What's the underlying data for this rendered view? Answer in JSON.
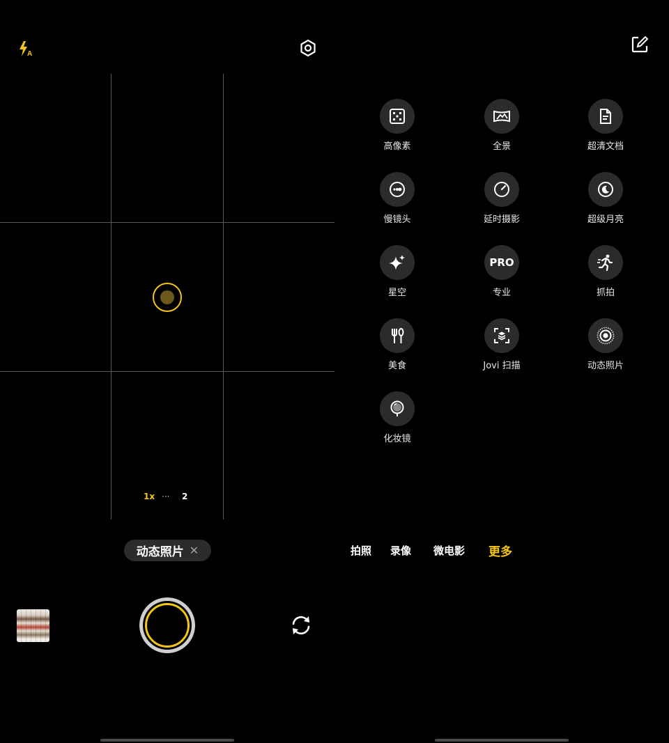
{
  "left_camera": {
    "zoom": {
      "active": "1x",
      "dots": "···",
      "next": "2"
    },
    "mode_chip": {
      "label": "动态照片",
      "close": "✕"
    }
  },
  "more_modes": [
    {
      "label": "高像素",
      "icon": "high-pixel-icon"
    },
    {
      "label": "全景",
      "icon": "panorama-icon"
    },
    {
      "label": "超清文档",
      "icon": "document-icon"
    },
    {
      "label": "慢镜头",
      "icon": "slow-motion-icon"
    },
    {
      "label": "延时摄影",
      "icon": "timelapse-icon"
    },
    {
      "label": "超级月亮",
      "icon": "moon-icon"
    },
    {
      "label": "星空",
      "icon": "sparkle-icon"
    },
    {
      "label": "专业",
      "icon": "pro-icon",
      "text": "PRO"
    },
    {
      "label": "抓拍",
      "icon": "runner-icon"
    },
    {
      "label": "美食",
      "icon": "fork-knife-icon"
    },
    {
      "label": "Jovi 扫描",
      "icon": "scan-icon"
    },
    {
      "label": "动态照片",
      "icon": "live-photo-icon"
    },
    {
      "label": "化妆镜",
      "icon": "mirror-icon"
    }
  ],
  "bottom_tabs": [
    {
      "label": "拍照",
      "active": false
    },
    {
      "label": "录像",
      "active": false
    },
    {
      "label": "微电影",
      "active": false
    },
    {
      "label": "更多",
      "active": true
    }
  ],
  "colors": {
    "accent": "#f5c518",
    "background": "#000000",
    "chip": "#2c2c2c"
  }
}
